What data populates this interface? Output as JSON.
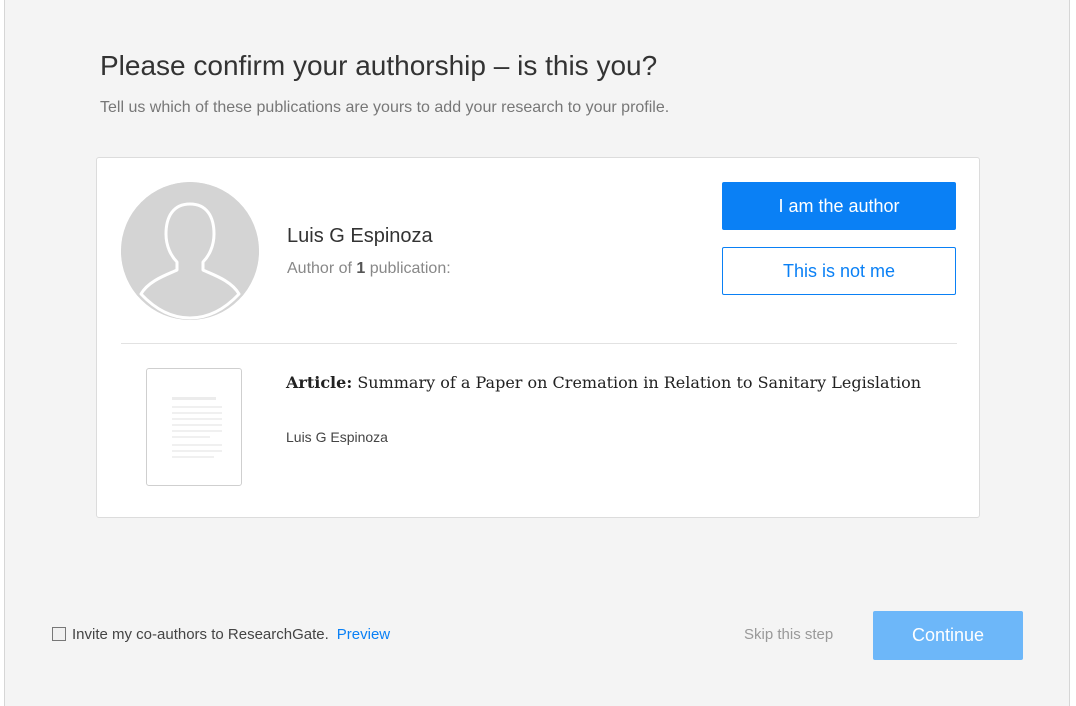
{
  "dialog": {
    "title": "Please confirm your authorship – is this you?",
    "subtitle": "Tell us which of these publications are yours to add your research to your profile."
  },
  "author": {
    "name": "Luis G Espinoza",
    "meta_prefix": "Author of ",
    "publication_count": "1",
    "meta_suffix": " publication:",
    "avatar_icon": "default-user-avatar-icon"
  },
  "actions": {
    "confirm_label": "I am the author",
    "reject_label": "This is not me"
  },
  "publication": {
    "type_label": "Article:",
    "title": "Summary of a Paper on Cremation in Relation to Sanitary Legislation",
    "authors": "Luis G Espinoza",
    "thumbnail_icon": "document-thumbnail-icon"
  },
  "footer": {
    "invite_label": "Invite my co-authors to ResearchGate.",
    "invite_checked": false,
    "preview_label": "Preview",
    "skip_label": "Skip this step",
    "continue_label": "Continue"
  },
  "colors": {
    "primary": "#0a80f5",
    "continue_disabled": "#6db7f9",
    "background": "#f4f4f4"
  }
}
